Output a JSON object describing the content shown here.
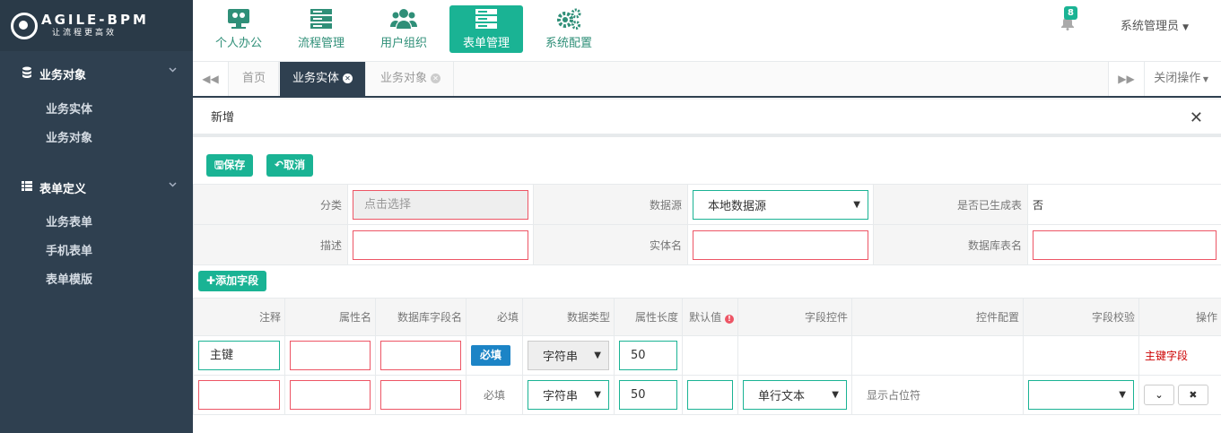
{
  "logo": {
    "line1": "AGILE-BPM",
    "line2": "让流程更高效"
  },
  "sidebar": {
    "groups": [
      {
        "label": "业务对象",
        "items": [
          "业务实体",
          "业务对象"
        ]
      },
      {
        "label": "表单定义",
        "items": [
          "业务表单",
          "手机表单",
          "表单模版"
        ]
      }
    ]
  },
  "topnav": {
    "items": [
      {
        "label": "个人办公",
        "icon": "desk-icon"
      },
      {
        "label": "流程管理",
        "icon": "server-icon"
      },
      {
        "label": "用户组织",
        "icon": "users-icon"
      },
      {
        "label": "表单管理",
        "icon": "server-icon",
        "active": true
      },
      {
        "label": "系统配置",
        "icon": "gears-icon"
      }
    ],
    "badge": "8",
    "user": "系统管理员"
  },
  "tabs": {
    "items": [
      "首页",
      "业务实体",
      "业务对象"
    ],
    "close_op": "关闭操作"
  },
  "panel": {
    "title": "新增",
    "save": "保存",
    "cancel": "取消",
    "add_field": "添加字段"
  },
  "form": {
    "category_label": "分类",
    "category_placeholder": "点击选择",
    "datasource_label": "数据源",
    "datasource_value": "本地数据源",
    "generated_label": "是否已生成表",
    "generated_value": "否",
    "desc_label": "描述",
    "entity_label": "实体名",
    "table_label": "数据库表名"
  },
  "fields": {
    "headers": [
      "注释",
      "属性名",
      "数据库字段名",
      "必填",
      "数据类型",
      "属性长度",
      "默认值",
      "字段控件",
      "控件配置",
      "字段校验",
      "操作"
    ],
    "rows": [
      {
        "comment": "主键",
        "required": "必填",
        "type": "字符串",
        "length": "50",
        "op": "主键字段"
      },
      {
        "comment": "",
        "required": "必填",
        "type": "字符串",
        "length": "50",
        "control": "单行文本",
        "config": "显示占位符"
      }
    ]
  },
  "colors": {
    "sidebar": "#2f4050",
    "accent": "#1ab394",
    "error": "#ed5565",
    "primary": "#1c84c6"
  }
}
